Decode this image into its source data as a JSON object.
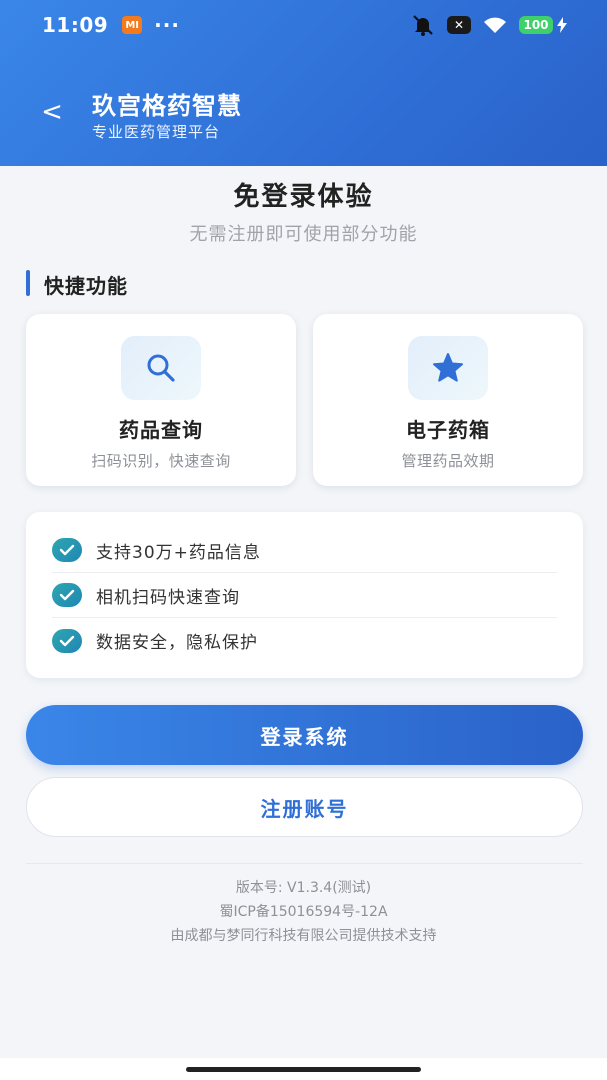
{
  "status_bar": {
    "time": "11:09",
    "mi_badge": "MI",
    "dots": "···",
    "x_badge": "✕",
    "battery": "100"
  },
  "header": {
    "back_label": "<",
    "title": "玖宫格药智慧",
    "subtitle": "专业医药管理平台"
  },
  "main": {
    "title": "免登录体验",
    "subtitle": "无需注册即可使用部分功能"
  },
  "section": {
    "title": "快捷功能"
  },
  "quick_actions": [
    {
      "title": "药品查询",
      "desc": "扫码识别，快速查询",
      "icon": "search-icon"
    },
    {
      "title": "电子药箱",
      "desc": "管理药品效期",
      "icon": "star-icon"
    }
  ],
  "features": [
    {
      "text": "支持30万+药品信息"
    },
    {
      "text": "相机扫码快速查询"
    },
    {
      "text": "数据安全，隐私保护"
    }
  ],
  "buttons": {
    "login": "登录系统",
    "register": "注册账号"
  },
  "footer": {
    "version": "版本号: V1.3.4(测试)",
    "icp": "蜀ICP备15016594号-12A",
    "support": "由成都与梦同行科技有限公司提供技术支持"
  },
  "colors": {
    "brand": "#2f6fd6",
    "check": "#1f87b4",
    "battery": "#3ed06a"
  }
}
